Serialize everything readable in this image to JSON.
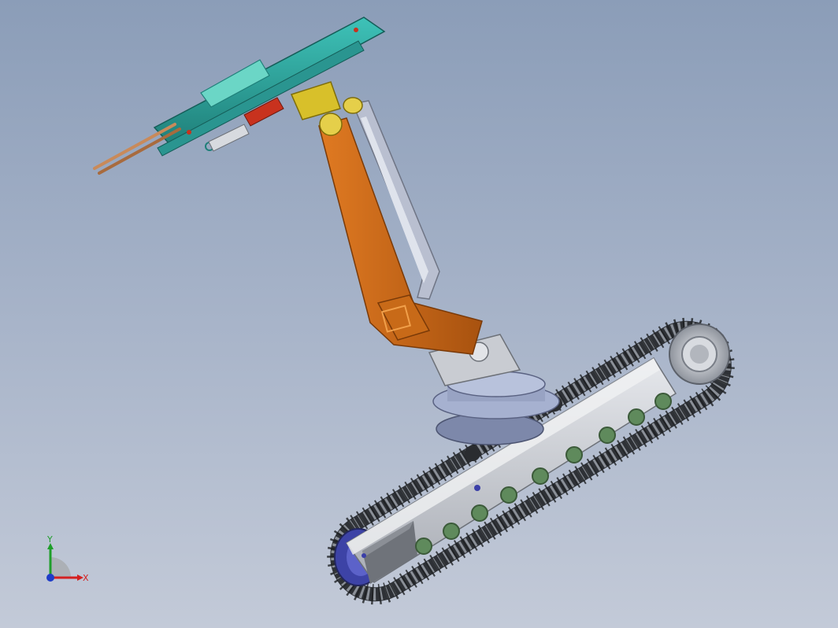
{
  "viewport": {
    "background_top": "#8b9db8",
    "background_bottom": "#c3cad8"
  },
  "model": {
    "parts": [
      {
        "name": "crawler-track",
        "color": "#3a3d42"
      },
      {
        "name": "track-frame",
        "color": "#c9ccd1"
      },
      {
        "name": "road-wheels",
        "color": "#5f8a5c"
      },
      {
        "name": "idler-wheel",
        "color": "#4a4fb0"
      },
      {
        "name": "drive-sprocket",
        "color": "#b8bcc4"
      },
      {
        "name": "turntable",
        "color": "#9aa6c8"
      },
      {
        "name": "lower-arm",
        "color": "#c8681a"
      },
      {
        "name": "link-arm",
        "color": "#b9bfd0"
      },
      {
        "name": "rotary-joint",
        "color": "#d8c02a"
      },
      {
        "name": "feed-beam",
        "color": "#2fa8a0"
      },
      {
        "name": "cylinder",
        "color": "#c8321e"
      },
      {
        "name": "drill-rods",
        "color": "#c98a5a"
      }
    ]
  },
  "triad": {
    "x_label": "X",
    "y_label": "Y",
    "x_color": "#d42020",
    "y_color": "#1e9e2a",
    "z_color": "#1e3cc8"
  }
}
